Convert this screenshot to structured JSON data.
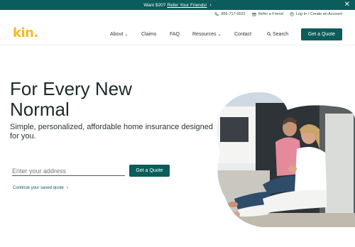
{
  "promo": {
    "text": "Want $20?",
    "link": "Refer Your Friends!",
    "chevron": "›",
    "close": "✕"
  },
  "utility": {
    "phone": "855-717-0022",
    "refer": "Refer a Friend",
    "login": "Log In / Create an Account"
  },
  "nav": {
    "logo": "kin.",
    "about": "About",
    "claims": "Claims",
    "faq": "FAQ",
    "resources": "Resources",
    "contact": "Contact",
    "search": "Search",
    "cta": "Get a Quote",
    "caret": "⌄"
  },
  "hero": {
    "title_line1": "For Every New",
    "title_line2": "Normal",
    "subtitle": "Simple, personalized, affordable home insurance designed for you.",
    "address_placeholder": "Enter your address",
    "cta": "Get a Quote",
    "saved_quote": "Continue your saved quote",
    "saved_chevron": "›"
  },
  "colors": {
    "brand_teal": "#0b5c5a",
    "logo_yellow": "#f5b82e"
  }
}
